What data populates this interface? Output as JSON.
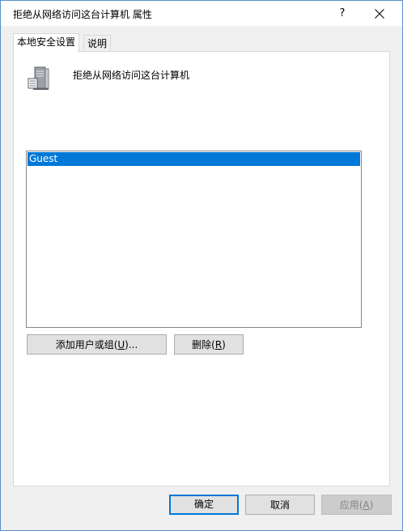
{
  "window": {
    "title": "拒绝从网络访问这台计算机 属性",
    "help_label": "?"
  },
  "tabs": [
    {
      "label": "本地安全设置",
      "active": true
    },
    {
      "label": "说明",
      "active": false
    }
  ],
  "policy": {
    "icon": "server-icon",
    "title": "拒绝从网络访问这台计算机"
  },
  "accounts_list": {
    "items": [
      {
        "name": "Guest",
        "selected": true
      }
    ]
  },
  "actions": {
    "add_label_pre": "添加用户或组(",
    "add_accel": "U",
    "add_label_post": ")...",
    "remove_label_pre": "删除(",
    "remove_accel": "R",
    "remove_label_post": ")"
  },
  "footer": {
    "ok_label": "确定",
    "cancel_label": "取消",
    "apply_label_pre": "应用(",
    "apply_accel": "A",
    "apply_label_post": ")",
    "apply_enabled": false
  },
  "colors": {
    "selection": "#0078d7",
    "window_border": "#5a8fc8",
    "dialog_bg": "#f0f0f0"
  }
}
